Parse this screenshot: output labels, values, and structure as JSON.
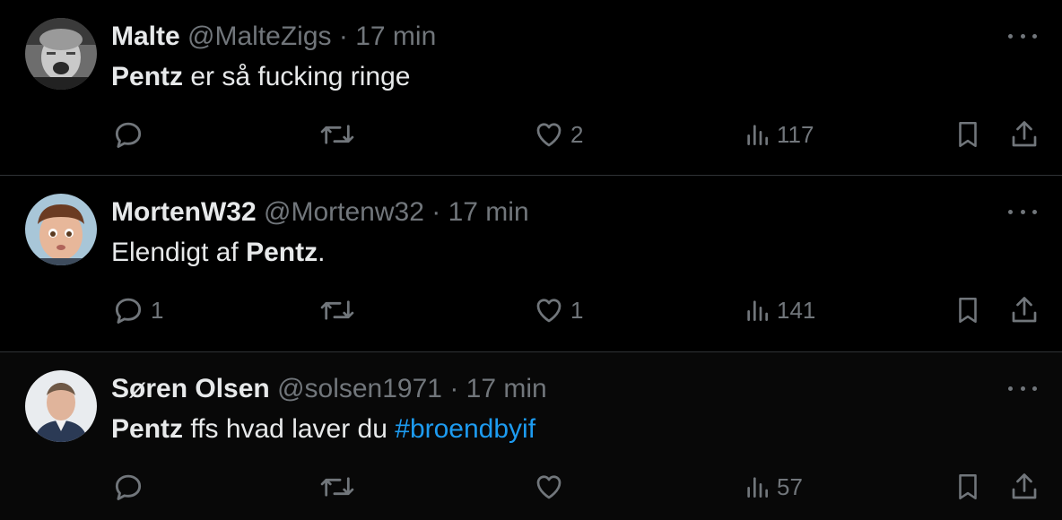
{
  "tweets": [
    {
      "name": "Malte",
      "handle": "@MalteZigs",
      "separator": "·",
      "time": "17 min",
      "text_bold": "Pentz",
      "text_rest": " er så fucking ringe",
      "reply_count": "",
      "retweet_count": "",
      "like_count": "2",
      "view_count": "117",
      "avatar_icon": "avatar-photo"
    },
    {
      "name": "MortenW32",
      "handle": "@Mortenw32",
      "separator": "·",
      "time": "17 min",
      "text_pre": "Elendigt af ",
      "text_bold": "Pentz",
      "text_post": ".",
      "reply_count": "1",
      "retweet_count": "",
      "like_count": "1",
      "view_count": "141",
      "avatar_icon": "avatar-photo"
    },
    {
      "name": "Søren Olsen",
      "handle": "@solsen1971",
      "separator": "·",
      "time": "17 min",
      "text_bold": "Pentz",
      "text_rest": " ffs hvad laver du ",
      "hashtag": "#broendbyif",
      "reply_count": "",
      "retweet_count": "",
      "like_count": "",
      "view_count": "57",
      "avatar_icon": "avatar-photo"
    }
  ],
  "colors": {
    "background": "#000000",
    "text": "#e7e9ea",
    "muted": "#71767b",
    "link": "#1d9bf0",
    "divider": "#2f3336"
  },
  "icons": [
    "reply-icon",
    "retweet-icon",
    "like-icon",
    "views-icon",
    "bookmark-icon",
    "share-icon",
    "more-icon"
  ]
}
